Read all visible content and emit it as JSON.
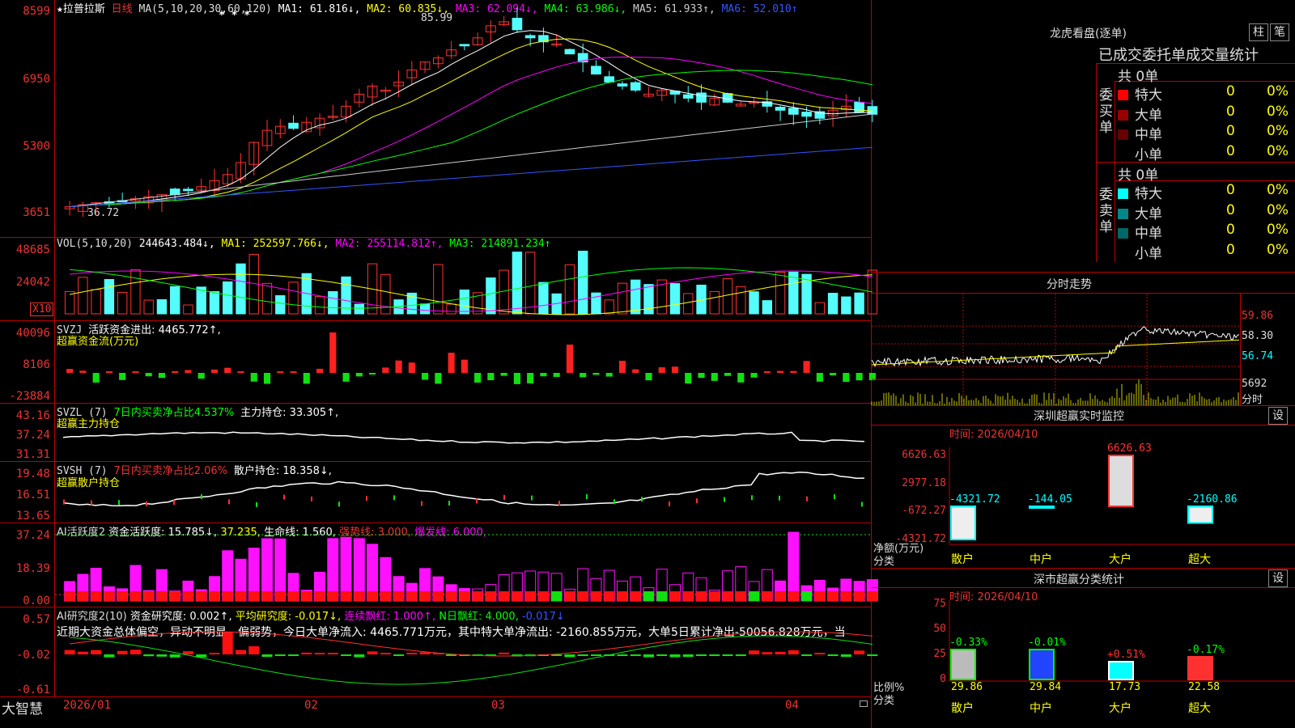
{
  "main_chart": {
    "title": "★拉普拉斯",
    "period": "日线",
    "ma_label": "MA(5,10,20,30,60,120)",
    "ma1": "MA1: 61.816↓,",
    "ma2": "MA2: 60.835↓,",
    "ma3": "MA3: 62.094↓,",
    "ma4": "MA4: 63.986↓,",
    "ma5": "MA5: 61.933↑,",
    "ma6": "MA6: 52.010↑",
    "y_axis": [
      "8599",
      "6950",
      "5300",
      "3651"
    ],
    "high_mark": "85.99",
    "low_mark": "36.72",
    "stars": "* * *",
    "colors": {
      "ma1": "#ffffff",
      "ma2": "#ffff00",
      "ma3": "#ff00ff",
      "ma4": "#00ff00",
      "ma5": "#cccccc",
      "ma6": "#3355ff"
    }
  },
  "vol_panel": {
    "label": "VOL(5,10,20)",
    "value": "244643.484↓,",
    "ma1": "MA1: 252597.766↓,",
    "ma2": "MA2: 255114.812↑,",
    "ma3": "MA3: 214891.234↑",
    "y_axis": [
      "48685",
      "24042"
    ],
    "unit": "X10"
  },
  "svzj_panel": {
    "label": "SVZJ",
    "desc": "活跃资金进出: 4465.772↑,",
    "sub": "超赢资金流(万元)",
    "y_axis": [
      "40096",
      "8106",
      "-23884"
    ]
  },
  "svzl_panel": {
    "label": "SVZL (7)",
    "desc": "7日内买卖净占比4.537%",
    "desc2": "主力持仓: 33.305↑,",
    "sub": "超赢主力持仓",
    "y_axis": [
      "43.16",
      "37.24",
      "31.31"
    ]
  },
  "svsh_panel": {
    "label": "SVSH (7)",
    "desc": "7日内买卖净占比2.06%",
    "desc2": "散户持仓: 18.358↓,",
    "sub": "超赢散户持仓",
    "y_axis": [
      "19.48",
      "16.51",
      "13.65"
    ]
  },
  "ai_active_panel": {
    "label": "AI活跃度2",
    "desc": "资金活跃度: 15.785↓,",
    "v2": "37.235,",
    "life": "生命线: 1.560,",
    "strong": "强势线: 3.000,",
    "burst": "爆发线: 6.000,",
    "y_axis": [
      "37.24",
      "18.39",
      "0.00"
    ]
  },
  "ai_research_panel": {
    "label": "AI研究度2(10)",
    "desc": "资金研究度: 0.002↑,",
    "avg": "平均研究度: -0.017↓,",
    "red": "连续飘红: 1.000↑,",
    "nred": "N日飘红: 4.000,",
    "last": "-0.017↓",
    "commentary": "近期大资金总体偏空，异动不明显，偏弱势，今日大单净流入: 4465.771万元，其中特大单净流出: -2160.855万元，大单5日累计净出-50056.828万元，当",
    "y_axis": [
      "0.57",
      "-0.02",
      "-0.61"
    ]
  },
  "bottom_bar": {
    "brand": "大智慧",
    "dates": [
      "2026/01",
      "02",
      "03",
      "04"
    ]
  },
  "dragon_tiger": {
    "title": "龙虎看盘(逐单)",
    "btn1": "柱",
    "btn2": "笔",
    "header": "已成交委托单成交量统计",
    "buy_label": "委买单",
    "sell_label": "委卖单",
    "buy_total": "共 0单",
    "sell_total": "共 0单",
    "buy_rows": [
      {
        "name": "特大",
        "count": "0",
        "pct": "0%",
        "color": "#ff0000"
      },
      {
        "name": "大单",
        "count": "0",
        "pct": "0%",
        "color": "#990000"
      },
      {
        "name": "中单",
        "count": "0",
        "pct": "0%",
        "color": "#660000"
      },
      {
        "name": "小单",
        "count": "0",
        "pct": "0%",
        "color": "#000000"
      }
    ],
    "sell_rows": [
      {
        "name": "特大",
        "count": "0",
        "pct": "0%",
        "color": "#00ffff"
      },
      {
        "name": "大单",
        "count": "0",
        "pct": "0%",
        "color": "#008888"
      },
      {
        "name": "中单",
        "count": "0",
        "pct": "0%",
        "color": "#006666"
      },
      {
        "name": "小单",
        "count": "0",
        "pct": "0%",
        "color": "#000000"
      }
    ]
  },
  "intraday": {
    "title": "分时走势",
    "y_axis": [
      "59.86",
      "58.30",
      "56.74"
    ],
    "vol_label": "5692",
    "vol_sub": "分时"
  },
  "sz_monitor": {
    "title": "深圳超赢实时监控",
    "btn": "设",
    "time_label": "时间: 2026/04/10",
    "y_axis": [
      "6626.63",
      "2977.18",
      "-672.27",
      "-4321.72"
    ],
    "axis_title": "净额(万元)",
    "axis_sub": "分类",
    "categories": [
      "散户",
      "中户",
      "大户",
      "超大"
    ],
    "values": [
      "-4321.72",
      "-144.05",
      "6626.63",
      "-2160.86"
    ]
  },
  "sz_class": {
    "title": "深市超赢分类统计",
    "btn": "设",
    "time_label": "时间: 2026/04/10",
    "y_axis": [
      "75",
      "50",
      "25",
      "0"
    ],
    "axis_title": "比例%",
    "axis_sub": "分类",
    "categories": [
      "散户",
      "中户",
      "大户",
      "超大"
    ],
    "top_values": [
      "-0.33%",
      "-0.01%",
      "+0.51%",
      "-0.17%"
    ],
    "bottom_values": [
      "29.86",
      "29.84",
      "17.73",
      "22.58"
    ]
  }
}
